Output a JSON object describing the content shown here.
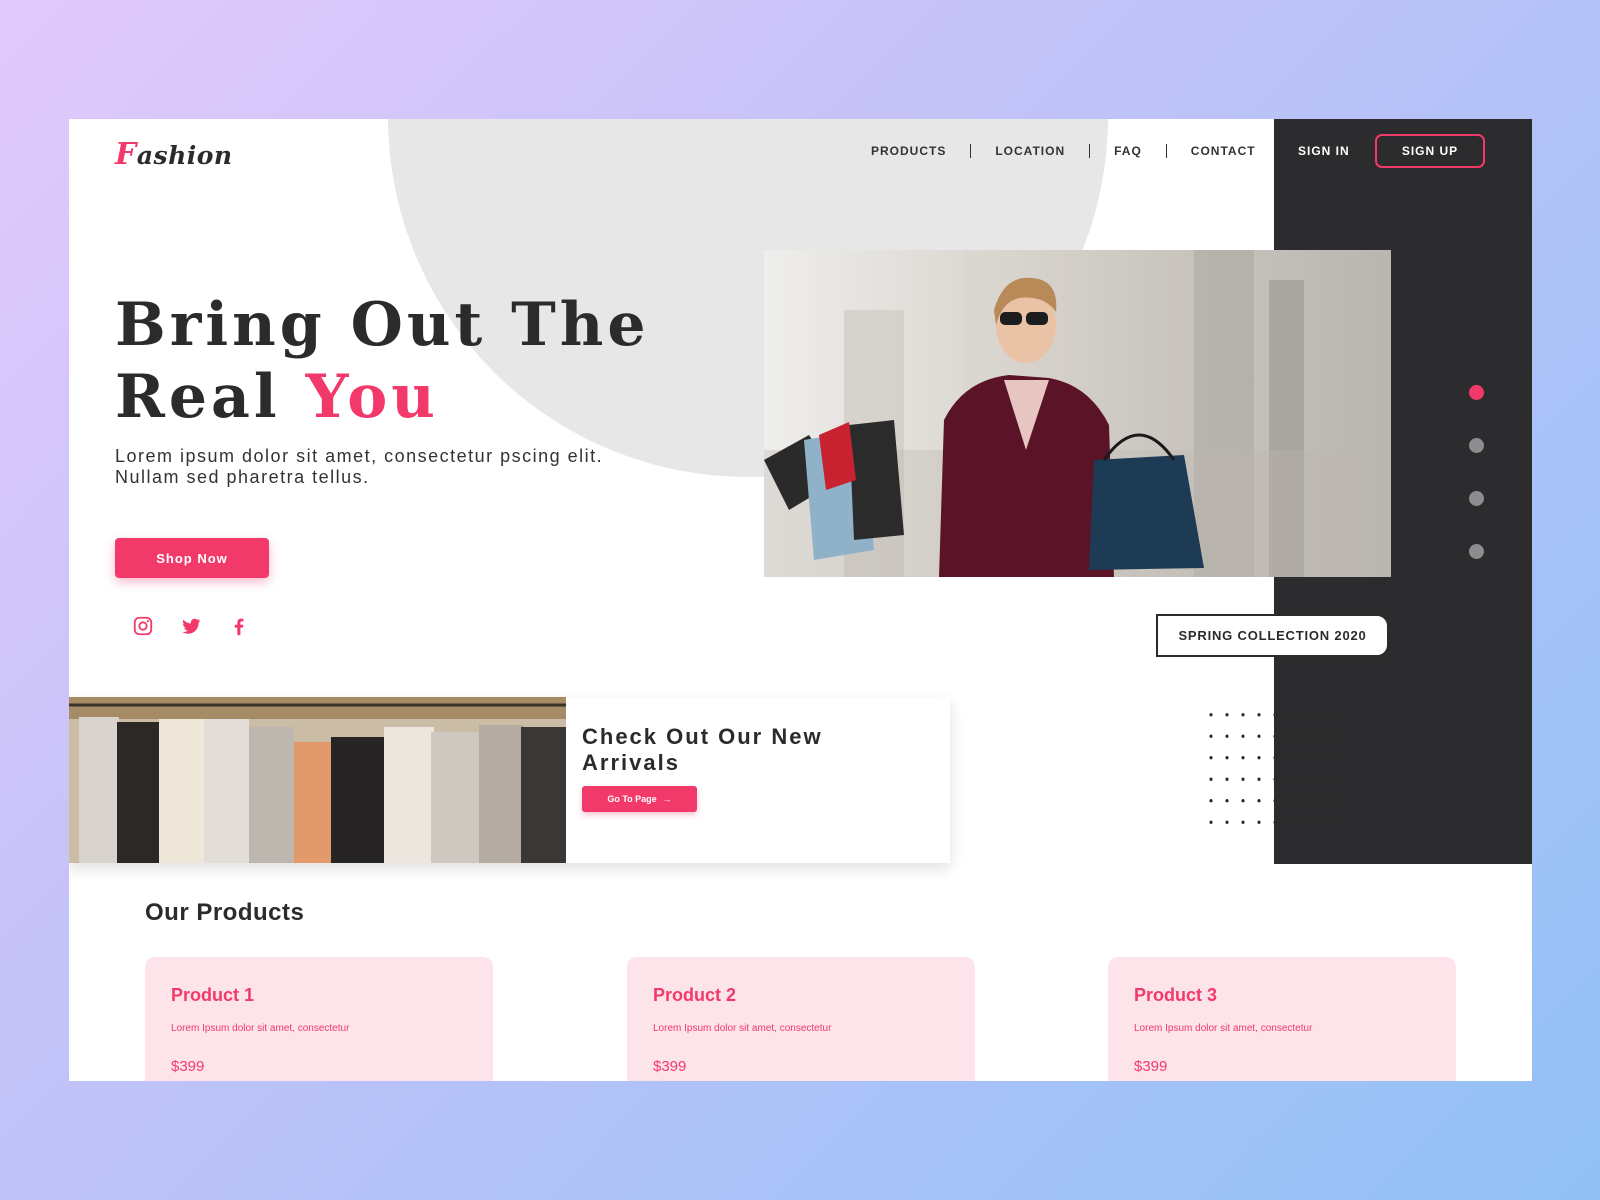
{
  "brand": {
    "logo_first": "F",
    "logo_rest": "ashion"
  },
  "nav": {
    "items": [
      {
        "label": "PRODUCTS"
      },
      {
        "label": "LOCATION"
      },
      {
        "label": "FAQ"
      },
      {
        "label": "CONTACT"
      }
    ],
    "sign_in": "SIGN IN",
    "sign_up": "SIGN UP"
  },
  "hero": {
    "title_line1": "Bring Out The",
    "title_line2_plain": "Real ",
    "title_line2_accent": "You",
    "subtitle": "Lorem ipsum dolor sit amet, consectetur pscing elit. Nullam sed pharetra tellus.",
    "cta": "Shop Now",
    "socials": [
      "instagram-icon",
      "twitter-icon",
      "facebook-icon"
    ],
    "collection_badge": "SPRING COLLECTION 2020",
    "slider_active_index": 0,
    "slider_count": 4
  },
  "arrivals": {
    "title": "Check Out Our New Arrivals",
    "cta": "Go To Page"
  },
  "products": {
    "heading": "Our Products",
    "items": [
      {
        "name": "Product 1",
        "desc": "Lorem Ipsum dolor sit amet, consectetur",
        "price": "$399"
      },
      {
        "name": "Product 2",
        "desc": "Lorem Ipsum dolor sit amet, consectetur",
        "price": "$399"
      },
      {
        "name": "Product 3",
        "desc": "Lorem Ipsum dolor sit amet, consectetur",
        "price": "$399"
      }
    ]
  },
  "colors": {
    "accent": "#f23a6a",
    "dark": "#2c2b2d",
    "card": "#fde3ea"
  }
}
